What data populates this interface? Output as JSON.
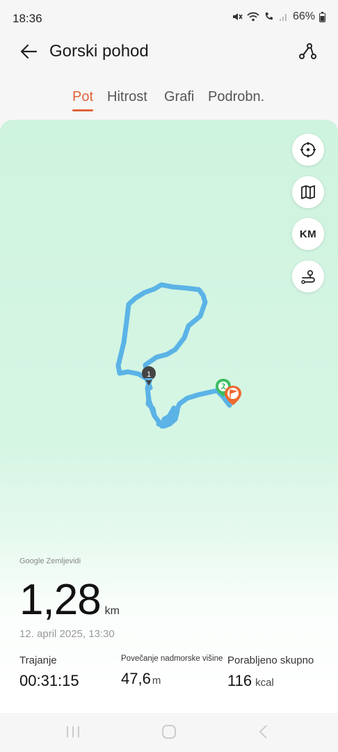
{
  "status": {
    "time": "18:36",
    "battery": "66%"
  },
  "header": {
    "title": "Gorski pohod"
  },
  "tabs": [
    "Pot",
    "Hitrost",
    "Grafi",
    "Podrobn."
  ],
  "map": {
    "attribution": "Google Zemljevidi",
    "unit_button": "KM",
    "marker_label": "1",
    "route_color": "#5bb3e6",
    "start_color": "#3ebd62",
    "end_color": "#ee6a2e"
  },
  "summary": {
    "distance_value": "1,28",
    "distance_unit": "km",
    "datetime": "12. april 2025, 13:30"
  },
  "stats": [
    {
      "label": "Trajanje",
      "value": "00:31:15",
      "unit": ""
    },
    {
      "label": "Povečanje nadmorske višine",
      "value": "47,6",
      "unit": "m"
    },
    {
      "label": "Porabljeno skupno",
      "value": "116",
      "unit": "kcal"
    }
  ],
  "colors": {
    "accent": "#e0643a",
    "map_bg": "#cef3df"
  }
}
